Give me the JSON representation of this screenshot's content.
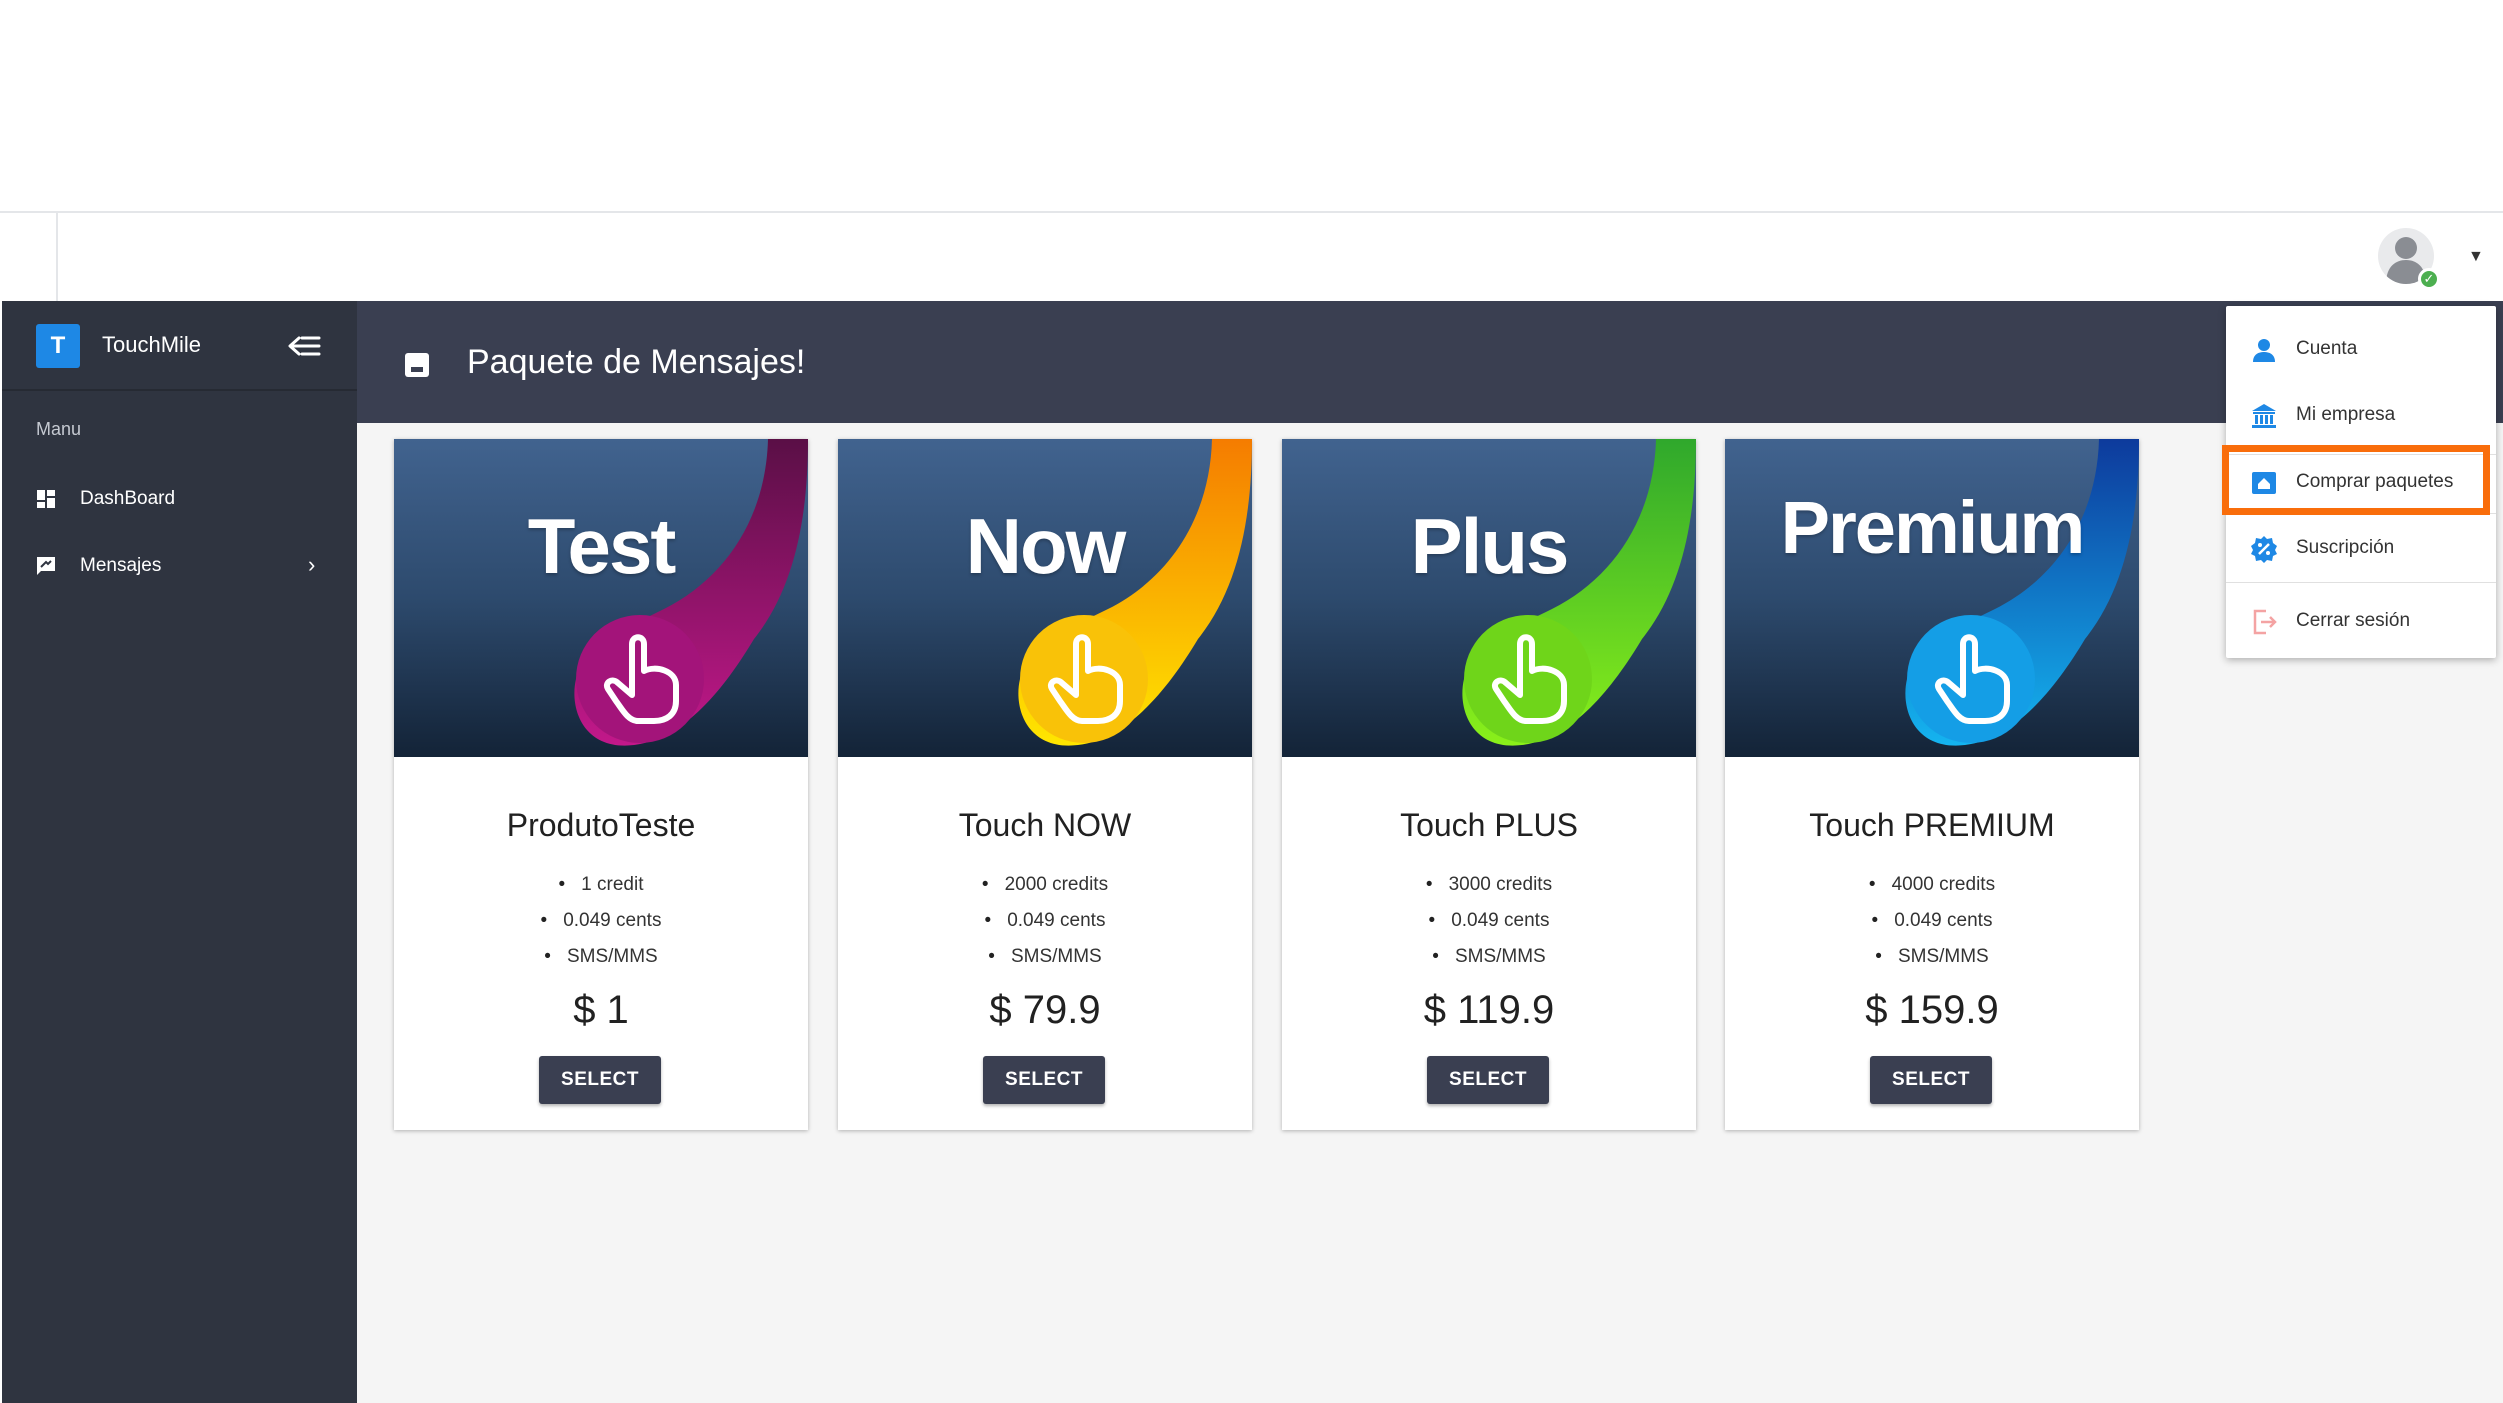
{
  "app": {
    "name": "TouchMile",
    "logo_letter": "T"
  },
  "sidebar": {
    "menu_heading": "Manu",
    "items": [
      {
        "label": "DashBoard",
        "icon": "dashboard-icon"
      },
      {
        "label": "Mensajes",
        "icon": "message-icon",
        "has_submenu": true
      }
    ]
  },
  "page": {
    "title": "Paquete de Mensajes!",
    "title_icon": "package-icon"
  },
  "packages": [
    {
      "banner_word": "Test",
      "name": "ProdutoTeste",
      "features": [
        "1 credit",
        "0.049 cents",
        "SMS/MMS"
      ],
      "price": "$ 1",
      "button": "SELECT",
      "accent": "#a3147a"
    },
    {
      "banner_word": "Now",
      "name": "Touch NOW",
      "features": [
        "2000 credits",
        "0.049 cents",
        "SMS/MMS"
      ],
      "price": "$ 79.9",
      "button": "SELECT",
      "accent": "#f9c208"
    },
    {
      "banner_word": "Plus",
      "name": "Touch PLUS",
      "features": [
        "3000 credits",
        "0.049 cents",
        "SMS/MMS"
      ],
      "price": "$ 119.9",
      "button": "SELECT",
      "accent": "#6fd51a"
    },
    {
      "banner_word": "Premium",
      "name": "Touch PREMIUM",
      "features": [
        "4000 credits",
        "0.049 cents",
        "SMS/MMS"
      ],
      "price": "$ 159.9",
      "button": "SELECT",
      "accent": "#149ee6"
    }
  ],
  "user_menu": {
    "items": [
      {
        "label": "Cuenta",
        "icon": "person-icon"
      },
      {
        "label": "Mi empresa",
        "icon": "bank-icon"
      },
      {
        "label": "Comprar paquetes",
        "icon": "buy-package-icon",
        "highlighted": true
      },
      {
        "label": "Suscripción",
        "icon": "subscription-icon"
      },
      {
        "label": "Cerrar sesión",
        "icon": "logout-icon"
      }
    ]
  },
  "colors": {
    "sidebar_bg": "#2f3440",
    "header_bg": "#3a3f51",
    "brand_blue": "#1e88e5",
    "highlight_orange": "#f96d0b",
    "online_green": "#4caf50"
  }
}
